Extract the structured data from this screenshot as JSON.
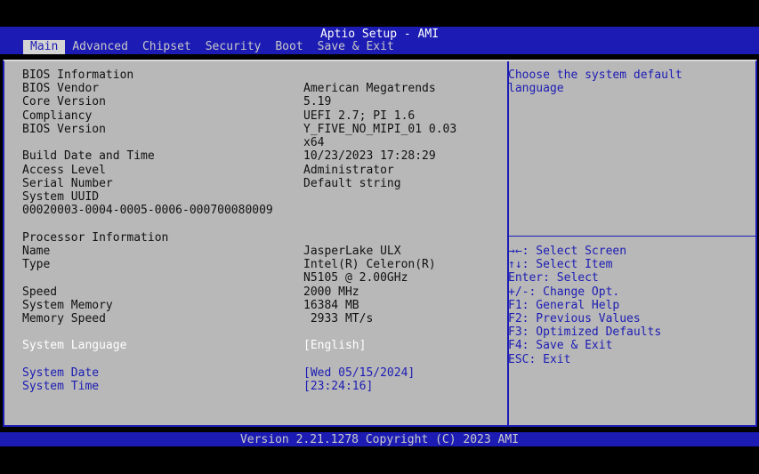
{
  "title": "Aptio Setup - AMI",
  "tabs": [
    {
      "label": "Main"
    },
    {
      "label": "Advanced"
    },
    {
      "label": "Chipset"
    },
    {
      "label": "Security"
    },
    {
      "label": "Boot"
    },
    {
      "label": "Save & Exit"
    }
  ],
  "info": {
    "bios_info_header": "BIOS Information",
    "bios_vendor": {
      "label": "BIOS Vendor",
      "value": "American Megatrends"
    },
    "core_version": {
      "label": "Core Version",
      "value": "5.19"
    },
    "compliancy": {
      "label": "Compliancy",
      "value": "UEFI 2.7; PI 1.6"
    },
    "bios_version": {
      "label": "BIOS Version",
      "value_line1": "Y_FIVE_NO_MIPI_01 0.03",
      "value_line2": "x64"
    },
    "build_date": {
      "label": "Build Date and Time",
      "value": "10/23/2023 17:28:29"
    },
    "access_level": {
      "label": "Access Level",
      "value": "Administrator"
    },
    "serial_number": {
      "label": "Serial Number",
      "value": "Default string"
    },
    "system_uuid": {
      "label": "System UUID",
      "value": "00020003-0004-0005-0006-000700080009"
    },
    "processor_header": "Processor Information",
    "name": {
      "label": "Name",
      "value": "JasperLake ULX"
    },
    "type": {
      "label": "Type",
      "value_line1": "Intel(R) Celeron(R)",
      "value_line2": "N5105 @ 2.00GHz"
    },
    "speed": {
      "label": "Speed",
      "value": "2000 MHz"
    },
    "system_memory": {
      "label": "System Memory",
      "value": "16384 MB"
    },
    "memory_speed": {
      "label": "Memory Speed",
      "value": " 2933 MT/s"
    }
  },
  "settings": {
    "system_language": {
      "label": "System Language",
      "value": "[English]"
    },
    "system_date": {
      "label": "System Date",
      "value": "[Wed 05/15/2024]"
    },
    "system_time": {
      "label": "System Time",
      "value": "[23:24:16]"
    }
  },
  "help": {
    "description_line1": "Choose the system default",
    "description_line2": "language",
    "keys": [
      "→←: Select Screen",
      "↑↓: Select Item",
      "Enter: Select",
      "+/-: Change Opt.",
      "F1: General Help",
      "F2: Previous Values",
      "F3: Optimized Defaults",
      "F4: Save & Exit",
      "ESC: Exit"
    ]
  },
  "footer": "Version 2.21.1278 Copyright (C) 2023 AMI",
  "colors": {
    "blue": "#1c1cb4",
    "panel": "#b8b8b8",
    "text": "#111111",
    "highlight": "#ffffff"
  }
}
